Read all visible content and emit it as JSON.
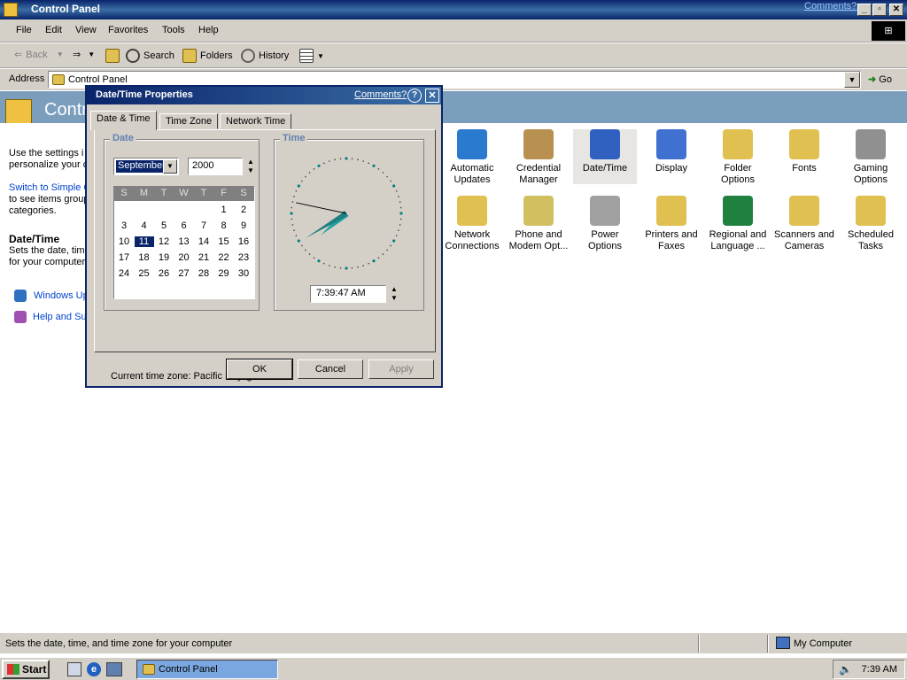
{
  "window": {
    "title": "Control Panel",
    "comments_link": "Comments?",
    "minimize_glyph": "_",
    "maximize_glyph": "▫",
    "close_glyph": "✕"
  },
  "menubar": {
    "items": [
      "File",
      "Edit",
      "View",
      "Favorites",
      "Tools",
      "Help"
    ]
  },
  "toolbar": {
    "back_label": "Back",
    "search_label": "Search",
    "folders_label": "Folders",
    "history_label": "History",
    "forward_glyph": "⇒",
    "back_glyph": "⇐"
  },
  "address": {
    "label": "Address",
    "value": "Control Panel",
    "go_label": "Go"
  },
  "header": {
    "title": "Contr"
  },
  "left_pane": {
    "intro_line1": "Use the settings i",
    "intro_line2": "personalize your c",
    "switch_link": "Switch to Simple C",
    "switch_line2": "to see items group",
    "switch_line3": "categories.",
    "section_title": "Date/Time",
    "section_desc1": "Sets the date, tim",
    "section_desc2": "for your computer",
    "link_windows_update": "Windows Up",
    "link_help": "Help and Sup"
  },
  "icons": [
    {
      "label1": "Automatic",
      "label2": "Updates",
      "icon": "globe-shield-icon",
      "color": "#2a7ad0"
    },
    {
      "label1": "Credential",
      "label2": "Manager",
      "icon": "keys-icon",
      "color": "#b89050"
    },
    {
      "label1": "Date/Time",
      "label2": "",
      "icon": "calendar-clock-icon",
      "color": "#3060c0",
      "selected": true
    },
    {
      "label1": "Display",
      "label2": "",
      "icon": "monitor-icon",
      "color": "#4070d0"
    },
    {
      "label1": "Folder Options",
      "label2": "",
      "icon": "folder-gear-icon",
      "color": "#e0c050"
    },
    {
      "label1": "Fonts",
      "label2": "",
      "icon": "fonts-folder-icon",
      "color": "#e0c050"
    },
    {
      "label1": "Gaming",
      "label2": "Options",
      "icon": "joystick-icon",
      "color": "#909090"
    },
    {
      "label1": "Network",
      "label2": "Connections",
      "icon": "network-folder-icon",
      "color": "#e0c050"
    },
    {
      "label1": "Phone and",
      "label2": "Modem Opt...",
      "icon": "phone-icon",
      "color": "#d0c060"
    },
    {
      "label1": "Power Options",
      "label2": "",
      "icon": "power-plug-icon",
      "color": "#a0a0a0"
    },
    {
      "label1": "Printers and",
      "label2": "Faxes",
      "icon": "printer-folder-icon",
      "color": "#e0c050"
    },
    {
      "label1": "Regional and",
      "label2": "Language ...",
      "icon": "globe-icon",
      "color": "#208040"
    },
    {
      "label1": "Scanners and",
      "label2": "Cameras",
      "icon": "scanner-folder-icon",
      "color": "#e0c050"
    },
    {
      "label1": "Scheduled",
      "label2": "Tasks",
      "icon": "scheduled-folder-icon",
      "color": "#e0c050"
    }
  ],
  "status": {
    "text": "Sets the date, time, and time zone for your computer",
    "zone": "My Computer"
  },
  "taskbar": {
    "start": "Start",
    "task": "Control Panel",
    "clock": "7:39 AM"
  },
  "dialog": {
    "title": "Date/Time Properties",
    "comments_link": "Comments?",
    "help_glyph": "?",
    "close_glyph": "✕",
    "tabs": [
      "Date & Time",
      "Time Zone",
      "Network Time"
    ],
    "active_tab": "Date & Time",
    "date_group": "Date",
    "time_group": "Time",
    "month": "September",
    "year": "2000",
    "weekdays": [
      "S",
      "M",
      "T",
      "W",
      "T",
      "F",
      "S"
    ],
    "weeks": [
      [
        "",
        "",
        "",
        "",
        "",
        "1",
        "2"
      ],
      [
        "3",
        "4",
        "5",
        "6",
        "7",
        "8",
        "9"
      ],
      [
        "10",
        "11",
        "12",
        "13",
        "14",
        "15",
        "16"
      ],
      [
        "17",
        "18",
        "19",
        "20",
        "21",
        "22",
        "23"
      ],
      [
        "24",
        "25",
        "26",
        "27",
        "28",
        "29",
        "30"
      ]
    ],
    "selected_day": "11",
    "time_value": "7:39:47 AM",
    "clock": {
      "hour": 7,
      "minute": 39,
      "second": 47
    },
    "timezone_label": "Current time zone:",
    "timezone_value": "Pacific Daylight Time",
    "ok": "OK",
    "cancel": "Cancel",
    "apply": "Apply"
  },
  "colors": {
    "titlebar": "#0a246a",
    "face": "#d4d0c8",
    "link": "#0044cc",
    "selection": "#0a246a"
  }
}
